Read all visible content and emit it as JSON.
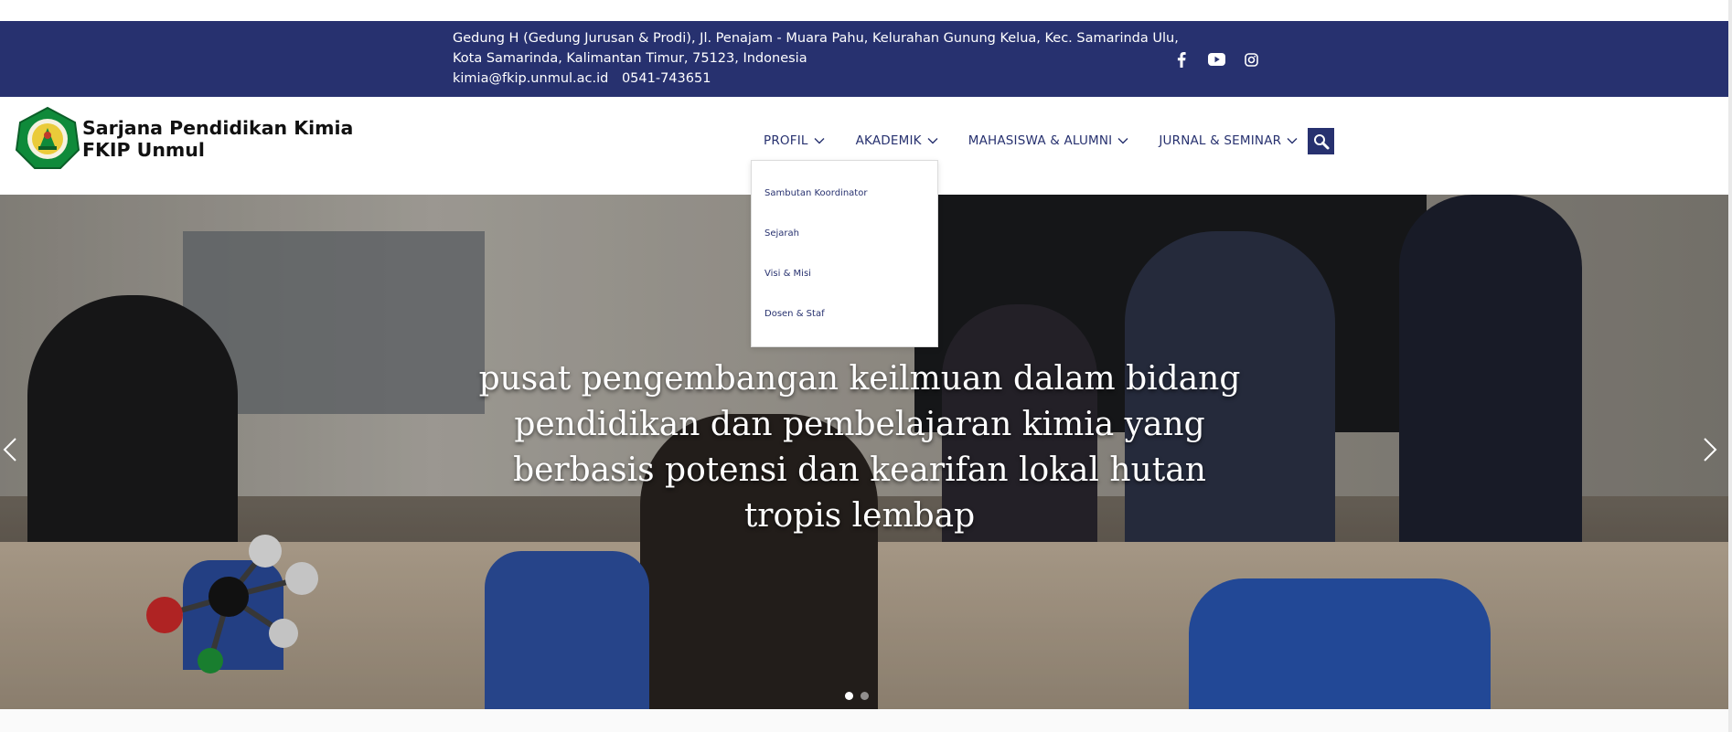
{
  "topbar": {
    "address_line1": "Gedung H (Gedung Jurusan & Prodi), Jl. Penajam - Muara Pahu, Kelurahan Gunung Kelua, Kec. Samarinda Ulu,",
    "address_line2": "Kota Samarinda, Kalimantan Timur, 75123, Indonesia",
    "email": "kimia@fkip.unmul.ac.id",
    "phone": "0541-743651",
    "social": [
      "facebook-icon",
      "youtube-icon",
      "instagram-icon"
    ]
  },
  "brand": {
    "line1": "Sarjana Pendidikan Kimia",
    "line2": "FKIP Unmul"
  },
  "nav": {
    "items": [
      {
        "label": "PROFIL"
      },
      {
        "label": "AKADEMIK"
      },
      {
        "label": "MAHASISWA & ALUMNI"
      },
      {
        "label": "JURNAL & SEMINAR"
      }
    ],
    "search_icon": "search-icon"
  },
  "dropdown": {
    "items": [
      "Sambutan Koordinator",
      "Sejarah",
      "Visi & Misi",
      "Dosen & Staf"
    ]
  },
  "hero": {
    "caption": "pusat pengembangan keilmuan dalam bidang pendidikan dan pembelajaran kimia yang berbasis potensi dan kearifan lokal hutan tropis lembap",
    "slide_count": 2,
    "active_slide": 1
  },
  "colors": {
    "primary": "#27316f",
    "white": "#ffffff"
  }
}
